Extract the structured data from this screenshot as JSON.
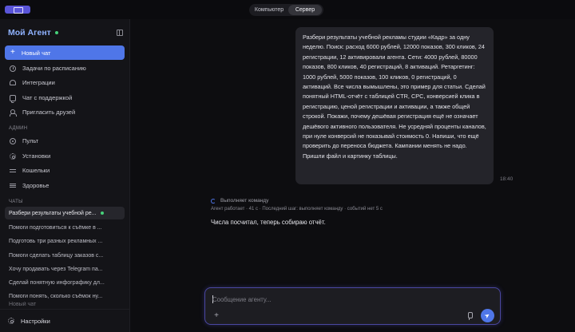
{
  "window": {
    "mode_tabs": [
      {
        "label": "Компьютер",
        "active": false
      },
      {
        "label": "Сервер",
        "active": true
      }
    ]
  },
  "sidebar": {
    "brand": "Мой Агент",
    "new_chat_label": "Новый чат",
    "nav_items": [
      {
        "label": "Задачи по расписанию",
        "icon": "clock-icon"
      },
      {
        "label": "Интеграции",
        "icon": "plug-icon"
      },
      {
        "label": "Чат с поддержкой",
        "icon": "chat-icon"
      },
      {
        "label": "Пригласить друзей",
        "icon": "users-icon"
      }
    ],
    "admin_label": "АДМИН",
    "admin_items": [
      {
        "label": "Пульт",
        "icon": "pulse-icon"
      },
      {
        "label": "Установки",
        "icon": "gear-icon"
      },
      {
        "label": "Кошельки",
        "icon": "wallet-icon"
      },
      {
        "label": "Здоровье",
        "icon": "health-icon"
      }
    ],
    "chats_label": "ЧАТЫ",
    "chats": [
      {
        "title": "Разбери результаты учебной ре...",
        "active": true
      },
      {
        "title": "Помоги подготовиться к съёмке в ..."
      },
      {
        "title": "Подготовь три разных рекламных ..."
      },
      {
        "title": "Помоги сделать таблицу заказов с..."
      },
      {
        "title": "Хочу продавать через Telegram па..."
      },
      {
        "title": "Сделай понятную инфографику дл..."
      },
      {
        "title": "Помоги понять, сколько съёмок ну..."
      },
      {
        "title": "Новый чат"
      }
    ],
    "settings_label": "Настройки"
  },
  "conversation": {
    "user_message": "Разбери результаты учебной рекламы студии «Кадр» за одну неделю. Поиск: расход 6000 рублей, 12000 показов, 300 кликов, 24 регистрации, 12 активировали агента. Сети: 4000 рублей, 80000 показов, 800 кликов, 40 регистраций, 8 активаций. Ретаргетинг: 1000 рублей, 5000 показов, 100 кликов, 0 регистраций, 0 активаций. Все числа вымышлены, это пример для статьи. Сделай понятный HTML-отчёт с таблицей CTR, CPC, конверсией клика в регистрацию, ценой регистрации и активации, а также общей строкой. Покажи, почему дешёвая регистрация ещё не означает дешёвого активного пользователя. Не усредняй проценты каналов, при нуле конверсий не показывай стоимость 0. Напиши, что ещё проверить до переноса бюджета. Кампании менять не надо. Пришли файл и картинку таблицы.",
    "user_time": "18:40",
    "agent_status": "Выполняет команду",
    "agent_meta": "Агент работает · 41 с · Последний шаг: выполняет команду · событий нет 5 с",
    "agent_reply": "Числа посчитал, теперь собираю отчёт."
  },
  "composer": {
    "placeholder": "Сообщение агенту..."
  },
  "colors": {
    "accent": "#4f76e8",
    "brand_text": "#8fb2ff",
    "online": "#46d17a"
  }
}
